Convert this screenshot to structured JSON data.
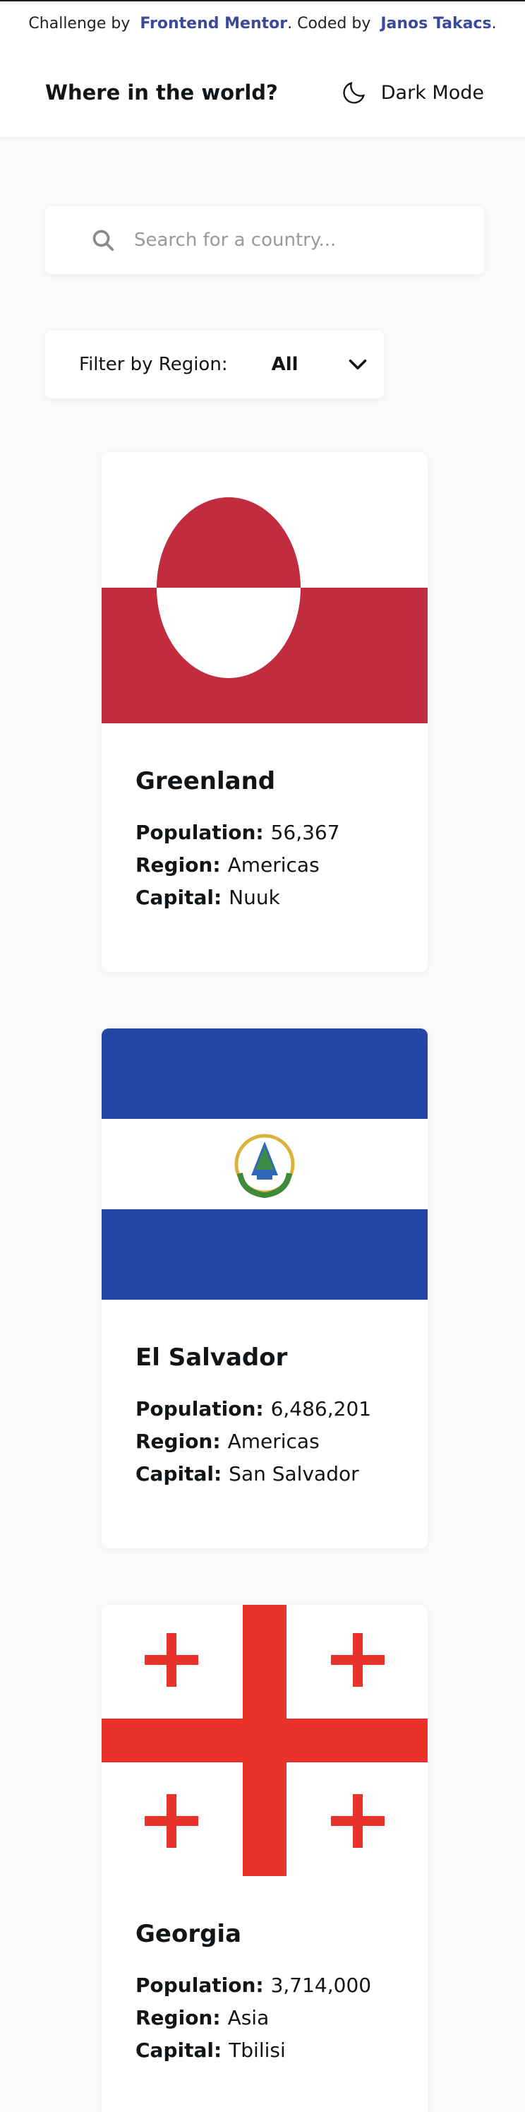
{
  "attribution": {
    "prefix": "Challenge by",
    "challenge_link": "Frontend Mentor",
    "middle": ". Coded by",
    "author_link": "Janos Takacs",
    "suffix": "."
  },
  "header": {
    "title": "Where in the world?",
    "theme_toggle_label": "Dark Mode"
  },
  "search": {
    "placeholder": "Search for a country..."
  },
  "filter": {
    "label": "Filter by Region:",
    "selected": "All"
  },
  "labels": {
    "population": "Population:",
    "region": "Region:",
    "capital": "Capital:"
  },
  "countries": [
    {
      "name": "Greenland",
      "population": "56,367",
      "region": "Americas",
      "capital": "Nuuk"
    },
    {
      "name": "El Salvador",
      "population": "6,486,201",
      "region": "Americas",
      "capital": "San Salvador"
    },
    {
      "name": "Georgia",
      "population": "3,714,000",
      "region": "Asia",
      "capital": "Tbilisi"
    }
  ],
  "colors": {
    "background": "#fafafa",
    "card": "#ffffff",
    "link": "#3b4a9a",
    "greenland_red": "#c12d3e",
    "salvador_blue": "#2447a6",
    "georgia_red": "#e8322a"
  }
}
